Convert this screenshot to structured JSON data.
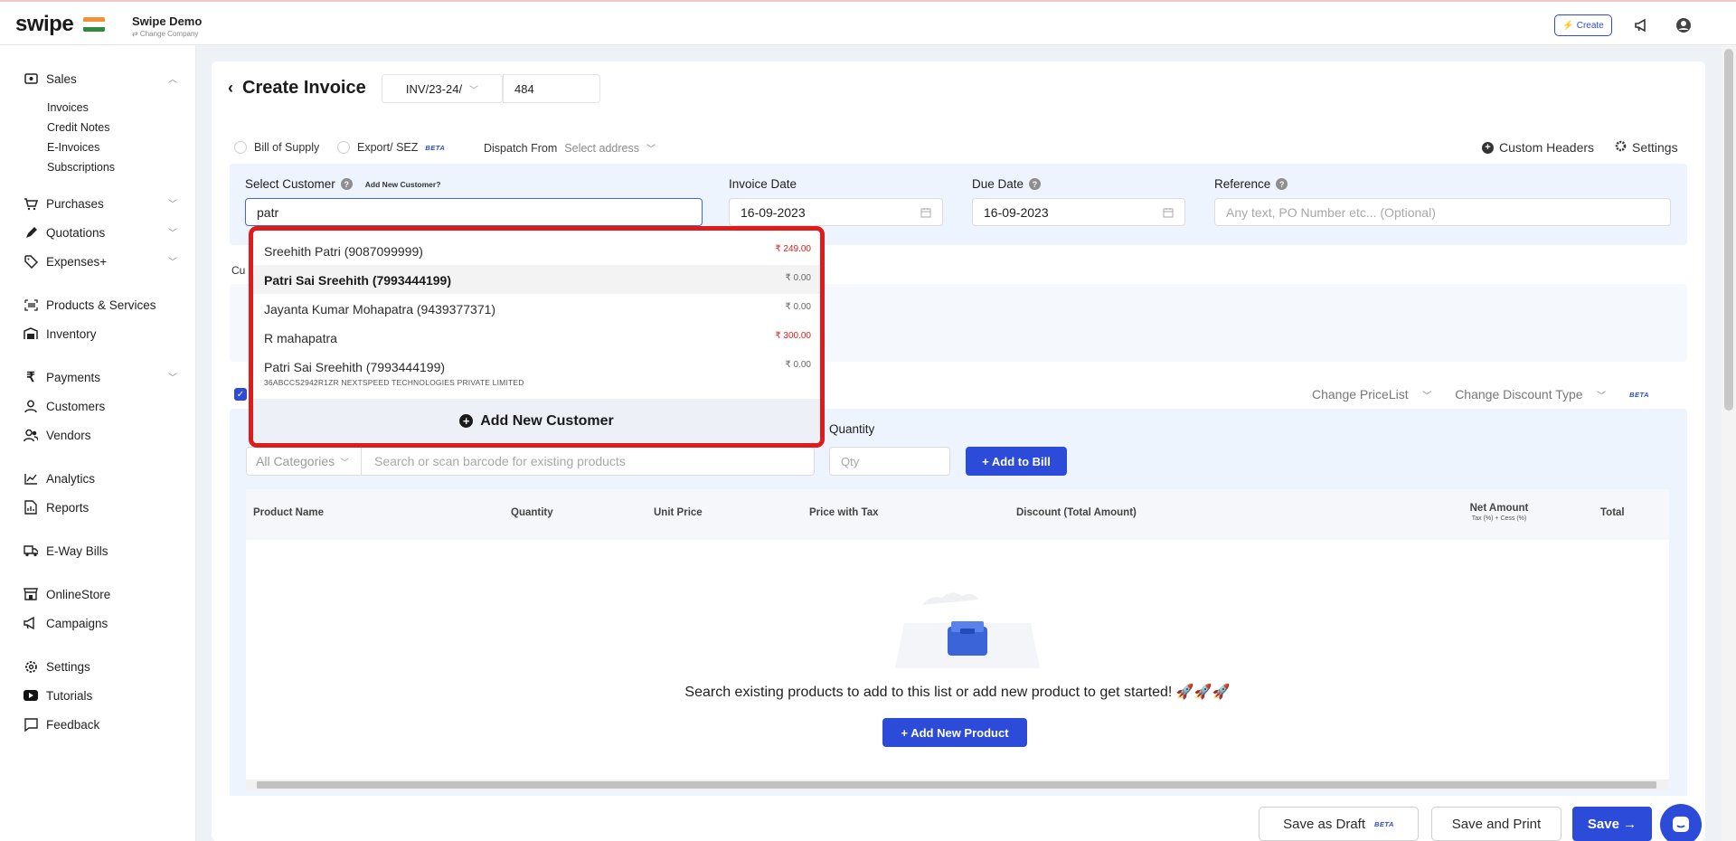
{
  "header": {
    "logo": "swipe",
    "company_name": "Swipe Demo",
    "change_company": "⇄ Change Company",
    "create_label": "Create"
  },
  "sidebar": {
    "sales": "Sales",
    "sales_sub": [
      "Invoices",
      "Credit Notes",
      "E-Invoices",
      "Subscriptions"
    ],
    "purchases": "Purchases",
    "quotations": "Quotations",
    "expenses": "Expenses+",
    "products": "Products & Services",
    "inventory": "Inventory",
    "payments": "Payments",
    "customers": "Customers",
    "vendors": "Vendors",
    "analytics": "Analytics",
    "reports": "Reports",
    "eway": "E-Way Bills",
    "onlinestore": "OnlineStore",
    "campaigns": "Campaigns",
    "settings": "Settings",
    "tutorials": "Tutorials",
    "feedback": "Feedback"
  },
  "page": {
    "title": "Create Invoice",
    "invoice_prefix": "INV/23-24/",
    "invoice_number": "484",
    "bill_of_supply": "Bill of Supply",
    "export_sez": "Export/ SEZ",
    "beta": "BETA",
    "dispatch_from": "Dispatch From",
    "select_address": "Select address",
    "custom_headers": "Custom Headers",
    "settings": "Settings"
  },
  "customer": {
    "label": "Select Customer",
    "add_new_link": "Add New Customer?",
    "search_value": "patr",
    "invoice_date_label": "Invoice Date",
    "invoice_date": "16-09-2023",
    "due_date_label": "Due Date",
    "due_date": "16-09-2023",
    "reference_label": "Reference",
    "reference_placeholder": "Any text, PO Number etc... (Optional)",
    "cu_label": "Cu"
  },
  "dropdown": {
    "items": [
      {
        "name": "Sreehith Patri (9087099999)",
        "amount": "₹ 249.00"
      },
      {
        "name": "Patri Sai Sreehith (7993444199)",
        "amount": "₹ 0.00"
      },
      {
        "name": "Jayanta Kumar Mohapatra (9439377371)",
        "amount": "₹ 0.00"
      },
      {
        "name": "R mahapatra",
        "amount": "₹ 300.00"
      },
      {
        "name": "Patri Sai Sreehith (7993444199)",
        "amount": "₹ 0.00",
        "sub": "36ABCCS2942R1ZR NEXTSPEED TECHNOLOGIES PRIVATE LIMITED"
      }
    ],
    "add_new": "Add New Customer"
  },
  "items": {
    "change_pricelist": "Change PriceList",
    "change_discount": "Change Discount Type",
    "beta": "BETA",
    "quantity_label": "Quantity",
    "all_categories": "All Categories",
    "search_placeholder": "Search or scan barcode for existing products",
    "qty_placeholder": "Qty",
    "add_to_bill": "+ Add to Bill",
    "columns": {
      "product_name": "Product Name",
      "quantity": "Quantity",
      "unit_price": "Unit Price",
      "price_with_tax": "Price with Tax",
      "discount": "Discount (Total Amount)",
      "net_amount": "Net Amount",
      "net_amount_sub": "Tax (%) + Cess (%)",
      "total": "Total"
    },
    "empty_message": "Search existing products to add to this list or add new product to get started! 🚀🚀🚀",
    "add_new_product": "+ Add New Product"
  },
  "footer": {
    "save_draft": "Save as Draft",
    "save_print": "Save and Print",
    "save": "Save →"
  },
  "colors": {
    "primary": "#2c4bd8",
    "highlight_border": "#e01b1b",
    "panel_bg": "#eef4fd"
  }
}
